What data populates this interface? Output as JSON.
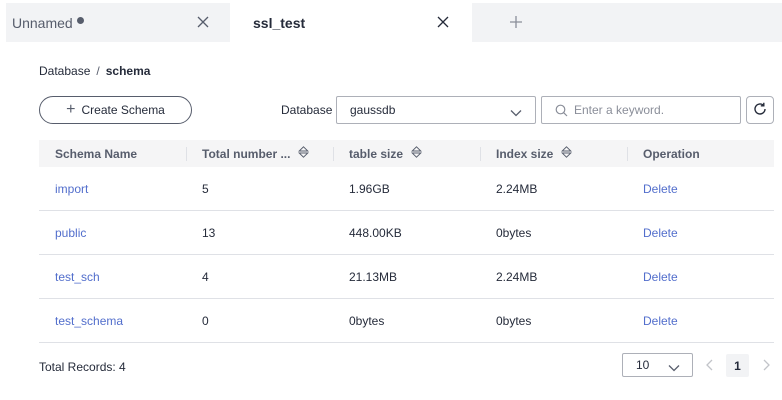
{
  "tabs": [
    {
      "label": "Unnamed",
      "unsaved": true
    },
    {
      "label": "ssl_test",
      "active": true
    }
  ],
  "breadcrumb": {
    "root": "Database",
    "separator": "/",
    "current": "schema"
  },
  "toolbar": {
    "create_label": "Create Schema",
    "database_label": "Database",
    "database_value": "gaussdb",
    "search_placeholder": "Enter a keyword."
  },
  "table": {
    "columns": [
      "Schema Name",
      "Total number ...",
      "table size",
      "Index size",
      "Operation"
    ],
    "rows": [
      {
        "name": "import",
        "total": "5",
        "table_size": "1.96GB",
        "index_size": "2.24MB",
        "operation": "Delete"
      },
      {
        "name": "public",
        "total": "13",
        "table_size": "448.00KB",
        "index_size": "0bytes",
        "operation": "Delete"
      },
      {
        "name": "test_sch",
        "total": "4",
        "table_size": "21.13MB",
        "index_size": "2.24MB",
        "operation": "Delete"
      },
      {
        "name": "test_schema",
        "total": "0",
        "table_size": "0bytes",
        "index_size": "0bytes",
        "operation": "Delete"
      }
    ]
  },
  "footer": {
    "total_records": "Total Records: 4",
    "page_size": "10",
    "current_page": "1"
  },
  "colors": {
    "link": "#526ecc",
    "header_bg": "#f5f5f6",
    "tab_inactive_bg": "#f2f3f5"
  }
}
